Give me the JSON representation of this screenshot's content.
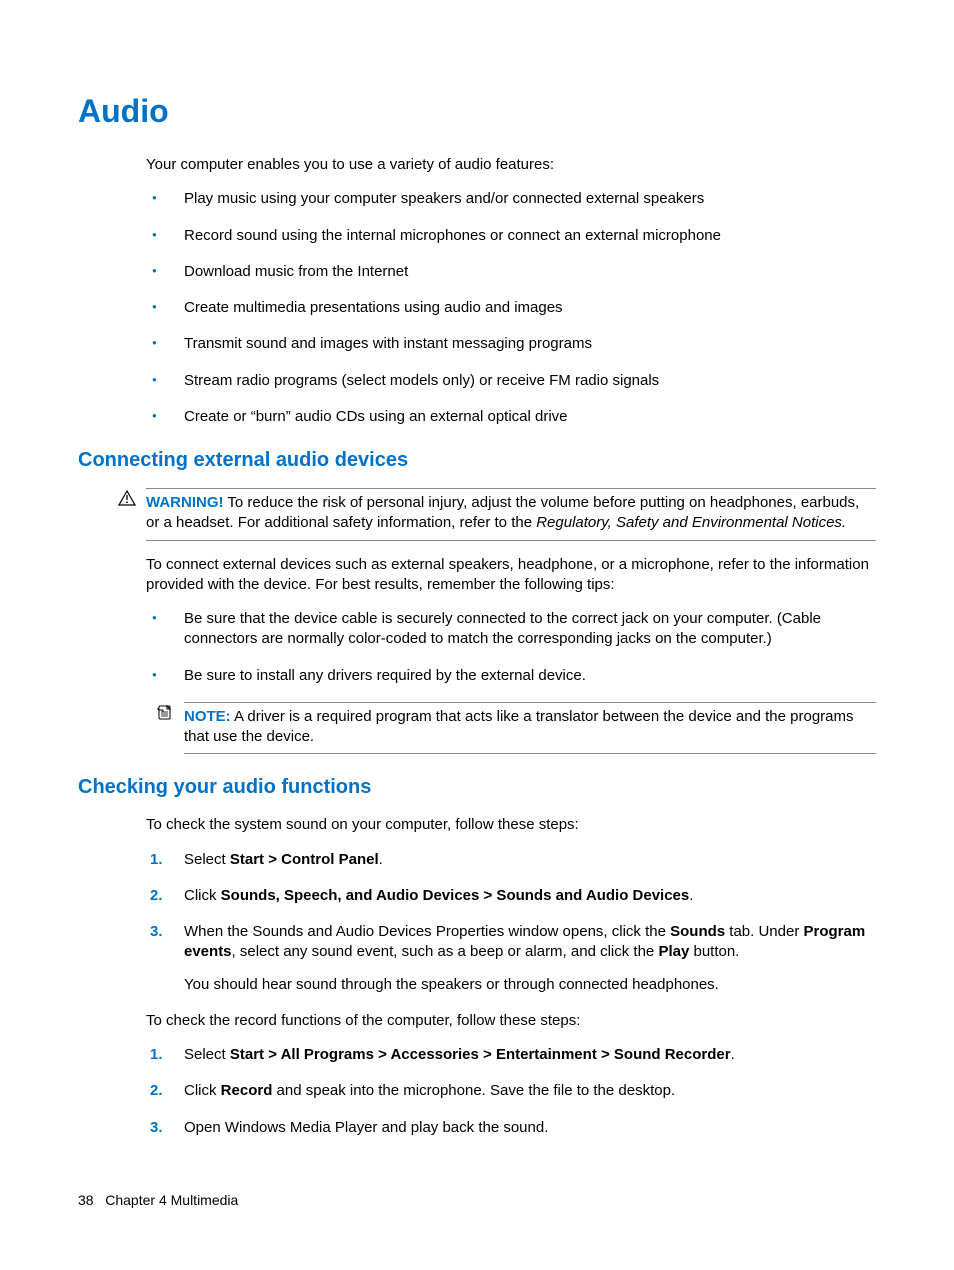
{
  "title": "Audio",
  "intro": "Your computer enables you to use a variety of audio features:",
  "features": [
    "Play music using your computer speakers and/or connected external speakers",
    "Record sound using the internal microphones or connect an external microphone",
    "Download music from the Internet",
    "Create multimedia presentations using audio and images",
    "Transmit sound and images with instant messaging programs",
    "Stream radio programs (select models only) or receive FM radio signals",
    "Create or “burn” audio CDs using an external optical drive"
  ],
  "section1": {
    "heading": "Connecting external audio devices",
    "warning_label": "WARNING!",
    "warning_text_part1": "To reduce the risk of personal injury, adjust the volume before putting on headphones, earbuds, or a headset. For additional safety information, refer to the ",
    "warning_italic": "Regulatory, Safety and Environmental Notices.",
    "p1": "To connect external devices such as external speakers, headphone, or a microphone, refer to the information provided with the device. For best results, remember the following tips:",
    "tips": [
      "Be sure that the device cable is securely connected to the correct jack on your computer. (Cable connectors are normally color-coded to match the corresponding jacks on the computer.)",
      "Be sure to install any drivers required by the external device."
    ],
    "note_label": "NOTE:",
    "note_text": "A driver is a required program that acts like a translator between the device and the programs that use the device."
  },
  "section2": {
    "heading": "Checking your audio functions",
    "p1": "To check the system sound on your computer, follow these steps:",
    "steps1": {
      "s1_a": "Select ",
      "s1_b": "Start > Control Panel",
      "s1_c": ".",
      "s2_a": "Click ",
      "s2_b": "Sounds, Speech, and Audio Devices > Sounds and Audio Devices",
      "s2_c": ".",
      "s3_a": "When the Sounds and Audio Devices Properties window opens, click the ",
      "s3_b": "Sounds",
      "s3_c": " tab. Under ",
      "s3_d": "Program events",
      "s3_e": ", select any sound event, such as a beep or alarm, and click the ",
      "s3_f": "Play",
      "s3_g": " button.",
      "s3_sub": "You should hear sound through the speakers or through connected headphones."
    },
    "p2": "To check the record functions of the computer, follow these steps:",
    "steps2": {
      "s1_a": "Select ",
      "s1_b": "Start > All Programs > Accessories > Entertainment > Sound Recorder",
      "s1_c": ".",
      "s2_a": "Click ",
      "s2_b": "Record",
      "s2_c": " and speak into the microphone. Save the file to the desktop.",
      "s3": "Open Windows Media Player and play back the sound."
    }
  },
  "footer": {
    "page": "38",
    "chapter": "Chapter 4   Multimedia"
  }
}
